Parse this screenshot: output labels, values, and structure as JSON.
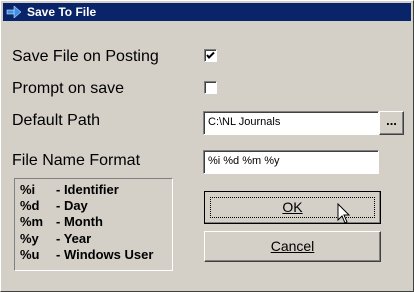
{
  "window": {
    "title": "Save To File"
  },
  "form": {
    "save_on_posting": {
      "label": "Save File on Posting",
      "checked": true
    },
    "prompt_on_save": {
      "label": "Prompt on save",
      "checked": false
    },
    "default_path": {
      "label": "Default Path",
      "value": "C:\\NL Journals",
      "browse_label": "..."
    },
    "file_name_format": {
      "label": "File Name Format",
      "value": "%i %d %m %y"
    }
  },
  "legend": [
    {
      "code": "%i",
      "meaning": "- Identifier"
    },
    {
      "code": "%d",
      "meaning": "- Day"
    },
    {
      "code": "%m",
      "meaning": "- Month"
    },
    {
      "code": "%y",
      "meaning": "- Year"
    },
    {
      "code": "%u",
      "meaning": "- Windows User"
    }
  ],
  "buttons": {
    "ok": "OK",
    "cancel": "Cancel"
  },
  "colors": {
    "titlebar": "#0a246a",
    "face": "#d4d0c8"
  }
}
